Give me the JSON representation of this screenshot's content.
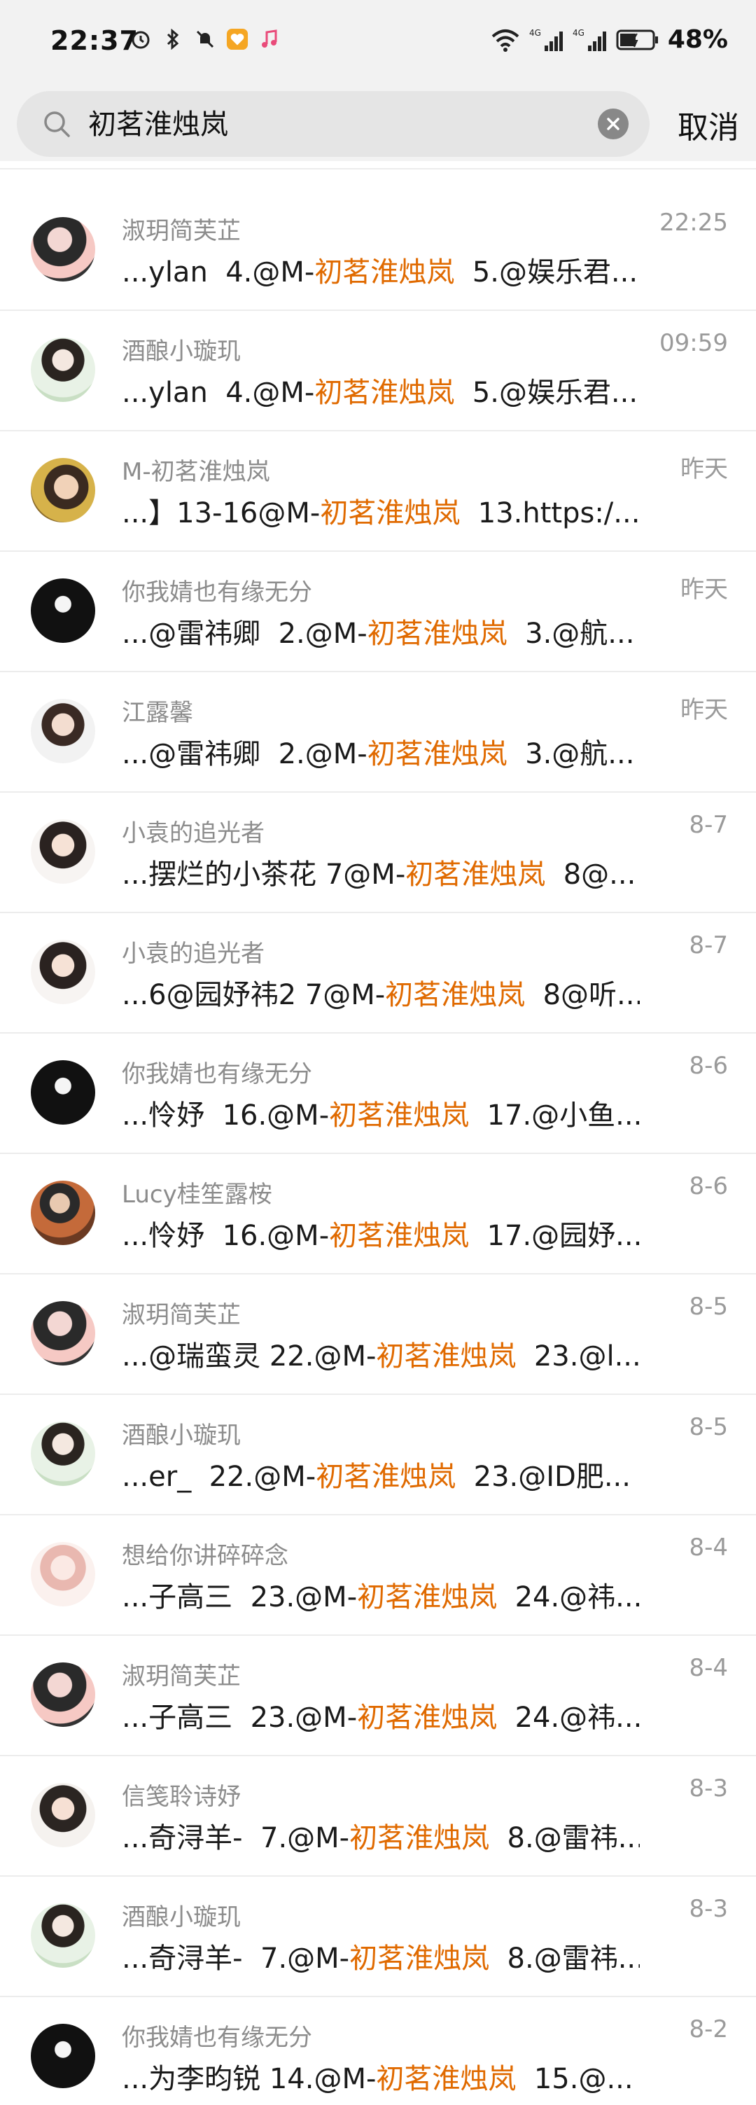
{
  "status_bar": {
    "time": "22:37",
    "battery": "48%",
    "network": "4G",
    "icons": [
      "alarm-icon",
      "bluetooth-icon",
      "mute-icon",
      "heart-app-icon",
      "music-icon",
      "wifi-icon",
      "signal-icon",
      "signal-icon",
      "battery-icon"
    ]
  },
  "search": {
    "query": "初茗淮烛岚",
    "cancel_label": "取消",
    "clear_icon": "close-circle-icon",
    "search_icon": "search-icon"
  },
  "colors": {
    "highlight": "#e06a00",
    "name_text": "#8c8c8c",
    "time_text": "#9a9a9a",
    "search_bg": "#e5e5e5"
  },
  "results": [
    {
      "name": "淑玥简芙芷",
      "pre": "...ylan  4.@M-",
      "hl": "初茗淮烛岚",
      "post": "  5.@娱乐君...",
      "time": "22:25",
      "avatar": "c1"
    },
    {
      "name": "酒酿小璇玑",
      "pre": "...ylan  4.@M-",
      "hl": "初茗淮烛岚",
      "post": "  5.@娱乐君...",
      "time": "09:59",
      "avatar": "c2"
    },
    {
      "name": "M-初茗淮烛岚",
      "pre": "...】13-16@M-",
      "hl": "初茗淮烛岚",
      "post": "  13.https:/...",
      "time": "昨天",
      "avatar": "c3"
    },
    {
      "name": "你我婧也有缘无分",
      "pre": "...@雷祎卿  2.@M-",
      "hl": "初茗淮烛岚",
      "post": "  3.@航...",
      "time": "昨天",
      "avatar": "c4"
    },
    {
      "name": "江露馨",
      "pre": "...@雷祎卿  2.@M-",
      "hl": "初茗淮烛岚",
      "post": "  3.@航...",
      "time": "昨天",
      "avatar": "c5"
    },
    {
      "name": "小袁的追光者",
      "pre": "...摆烂的小茶花 7@M-",
      "hl": "初茗淮烛岚",
      "post": "  8@...",
      "time": "8-7",
      "avatar": "c6"
    },
    {
      "name": "小袁的追光者",
      "pre": "...6@园妤祎2 7@M-",
      "hl": "初茗淮烛岚",
      "post": "  8@听...",
      "time": "8-7",
      "avatar": "c6"
    },
    {
      "name": "你我婧也有缘无分",
      "pre": "...怜妤  16.@M-",
      "hl": "初茗淮烛岚",
      "post": "  17.@小鱼...",
      "time": "8-6",
      "avatar": "c4"
    },
    {
      "name": "Lucy桂笙露桉",
      "pre": "...怜妤  16.@M-",
      "hl": "初茗淮烛岚",
      "post": "  17.@园妤...",
      "time": "8-6",
      "avatar": "c7"
    },
    {
      "name": "淑玥简芙芷",
      "pre": "...@瑞蛮灵 22.@M-",
      "hl": "初茗淮烛岚",
      "post": "  23.@l...",
      "time": "8-5",
      "avatar": "c1"
    },
    {
      "name": "酒酿小璇玑",
      "pre": "...er_  22.@M-",
      "hl": "初茗淮烛岚",
      "post": "  23.@ID肥...",
      "time": "8-5",
      "avatar": "c2"
    },
    {
      "name": "想给你讲碎碎念",
      "pre": "...子高三  23.@M-",
      "hl": "初茗淮烛岚",
      "post": "  24.@祎...",
      "time": "8-4",
      "avatar": "c8"
    },
    {
      "name": "淑玥简芙芷",
      "pre": "...子高三  23.@M-",
      "hl": "初茗淮烛岚",
      "post": "  24.@祎...",
      "time": "8-4",
      "avatar": "c1"
    },
    {
      "name": "信笺聆诗妤",
      "pre": "...奇浔羊-  7.@M-",
      "hl": "初茗淮烛岚",
      "post": "  8.@雷祎...",
      "time": "8-3",
      "avatar": "c9"
    },
    {
      "name": "酒酿小璇玑",
      "pre": "...奇浔羊-  7.@M-",
      "hl": "初茗淮烛岚",
      "post": "  8.@雷祎...",
      "time": "8-3",
      "avatar": "c2"
    },
    {
      "name": "你我婧也有缘无分",
      "pre": "...为李昀锐 14.@M-",
      "hl": "初茗淮烛岚",
      "post": "  15.@...",
      "time": "8-2",
      "avatar": "c4"
    }
  ]
}
